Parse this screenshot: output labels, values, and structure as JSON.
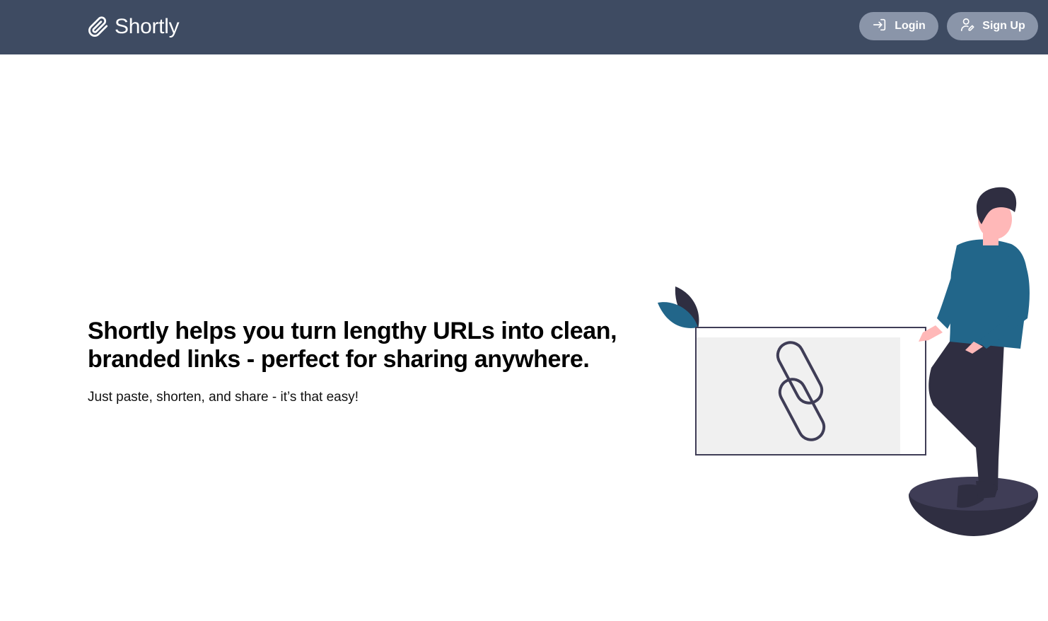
{
  "navbar": {
    "brand": "Shortly",
    "brand_icon": "paperclip-icon",
    "login_label": "Login",
    "login_icon": "login-arrow-icon",
    "signup_label": "Sign Up",
    "signup_icon": "user-edit-icon"
  },
  "hero": {
    "title": "Shortly helps you turn lengthy URLs into clean, branded links - perfect for sharing anywhere.",
    "subtitle": "Just paste, shorten, and share - it’s that easy!"
  },
  "colors": {
    "navbar_bg": "#3e4b62",
    "button_bg": "#8a95a9",
    "accent_teal": "#22668a",
    "dark": "#2f2e41"
  }
}
